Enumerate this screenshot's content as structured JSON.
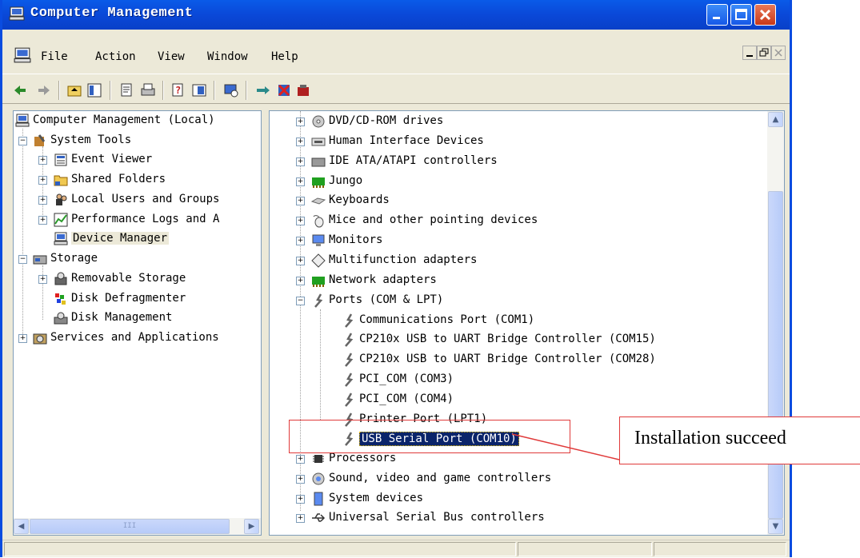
{
  "window": {
    "title": "Computer Management"
  },
  "menubar": {
    "items": [
      "File",
      "Action",
      "View",
      "Window",
      "Help"
    ]
  },
  "toolbar": {
    "icons": [
      "back-arrow-icon",
      "forward-arrow-icon",
      "up-folder-icon",
      "show-hide-tree-icon",
      "properties-icon",
      "print-icon",
      "help-icon",
      "export-list-icon",
      "scan-hardware-icon",
      "update-driver-icon",
      "uninstall-icon",
      "disable-icon"
    ]
  },
  "tree": {
    "items": [
      {
        "label": "Computer Management (Local)",
        "icon": "computer-icon"
      },
      {
        "label": "System Tools",
        "icon": "tools-icon"
      },
      {
        "label": "Event Viewer",
        "icon": "event-viewer-icon"
      },
      {
        "label": "Shared Folders",
        "icon": "folder-icon"
      },
      {
        "label": "Local Users and Groups",
        "icon": "users-icon"
      },
      {
        "label": "Performance Logs and A",
        "icon": "performance-icon"
      },
      {
        "label": "Device Manager",
        "icon": "device-manager-icon"
      },
      {
        "label": "Storage",
        "icon": "storage-icon"
      },
      {
        "label": "Removable Storage",
        "icon": "removable-storage-icon"
      },
      {
        "label": "Disk Defragmenter",
        "icon": "defrag-icon"
      },
      {
        "label": "Disk Management",
        "icon": "disk-management-icon"
      },
      {
        "label": "Services and Applications",
        "icon": "services-icon"
      }
    ],
    "hscroll_grip": "III"
  },
  "devices": {
    "items": [
      {
        "label": "DVD/CD-ROM drives",
        "icon": "dvd-icon"
      },
      {
        "label": "Human Interface Devices",
        "icon": "hid-icon"
      },
      {
        "label": "IDE ATA/ATAPI controllers",
        "icon": "ide-icon"
      },
      {
        "label": "Jungo",
        "icon": "jungo-icon"
      },
      {
        "label": "Keyboards",
        "icon": "keyboard-icon"
      },
      {
        "label": "Mice and other pointing devices",
        "icon": "mouse-icon"
      },
      {
        "label": "Monitors",
        "icon": "monitor-icon"
      },
      {
        "label": "Multifunction adapters",
        "icon": "multifunction-icon"
      },
      {
        "label": "Network adapters",
        "icon": "network-icon"
      },
      {
        "label": "Ports (COM & LPT)",
        "icon": "port-icon"
      },
      {
        "label": "Communications Port (COM1)",
        "icon": "port-icon"
      },
      {
        "label": "CP210x USB to UART Bridge Controller (COM15)",
        "icon": "port-icon"
      },
      {
        "label": "CP210x USB to UART Bridge Controller (COM28)",
        "icon": "port-icon"
      },
      {
        "label": "PCI_COM (COM3)",
        "icon": "port-icon"
      },
      {
        "label": "PCI_COM (COM4)",
        "icon": "port-icon"
      },
      {
        "label": "Printer Port (LPT1)",
        "icon": "port-icon"
      },
      {
        "label": "USB Serial Port (COM10)",
        "icon": "port-icon"
      },
      {
        "label": "Processors",
        "icon": "processor-icon"
      },
      {
        "label": "Sound, video and game controllers",
        "icon": "sound-icon"
      },
      {
        "label": "System devices",
        "icon": "system-icon"
      },
      {
        "label": "Universal Serial Bus controllers",
        "icon": "usb-icon"
      }
    ]
  },
  "annotation": {
    "text": "Installation succeed",
    "color": "#e03a3a"
  },
  "colors": {
    "titlebar": "#0a48d8",
    "selection": "#0a246a",
    "window_bg": "#ece9d8"
  }
}
